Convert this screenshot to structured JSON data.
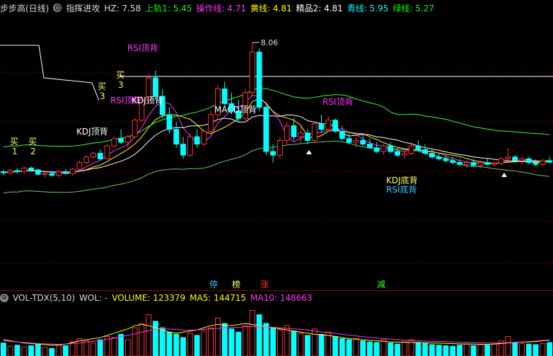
{
  "header": {
    "title": "步步高(日线)",
    "indicator": "指挥进攻",
    "items": [
      {
        "label": "HZ:",
        "value": "7.58",
        "color": "#e0e0e0"
      },
      {
        "label": "上轨1:",
        "value": "5.45",
        "color": "#00ff00"
      },
      {
        "label": "操作线:",
        "value": "4.71",
        "color": "#ff33ff"
      },
      {
        "label": "黄线:",
        "value": "4.81",
        "color": "#ffff00"
      },
      {
        "label": "精品2:",
        "value": "4.81",
        "color": "#ffffff"
      },
      {
        "label": "青线:",
        "value": "5.95",
        "color": "#00ffff"
      },
      {
        "label": "绿线:",
        "value": "5.27",
        "color": "#00ff00"
      }
    ]
  },
  "vol_header": {
    "name": "VOL-TDX(5,10)",
    "wol_label": "WOL: -",
    "volume_label": "VOLUME: 123379",
    "ma5_label": "MA5: 144715",
    "ma10_label": "MA10: 148663"
  },
  "annotations": {
    "max_price": "8.06",
    "rsi_top_1": "RSI顶背",
    "rsi_top_2": "RSI顶背",
    "rsi_top_3": "RSI顶背",
    "kdj_top_1": "KDJ顶背",
    "kdj_top_2": "KDJ顶背",
    "macd_top": "MACD顶背",
    "kdj_bottom": "KDJ底背",
    "rsi_bottom": "RSI底背",
    "buy_1": "买",
    "buy_1_num": "1",
    "buy_2": "买",
    "buy_2_num": "2",
    "buy_3a": "买",
    "buy_3a_num": "3",
    "buy_3b": "买",
    "buy_3b_num": "3",
    "mark_ting": "停",
    "mark_bang": "榜",
    "mark_zhang": "涨",
    "mark_jian": "减"
  },
  "colors": {
    "up": "#ff3333",
    "down": "#00ffff",
    "ma_yellow": "#ffff00",
    "ma_white": "#ffffff",
    "ma_magenta": "#ff33ff",
    "ma_green": "#33ff33",
    "ma_lightgreen": "#66cc66",
    "annotation_magenta": "#ff33ff",
    "annotation_white": "#ffffff",
    "annotation_yellow": "#ffff66",
    "annotation_cyan": "#33ccff"
  },
  "chart_data": {
    "type": "candlestick",
    "max_price": 8.06,
    "candles": [
      [
        4.55,
        4.6,
        4.45,
        4.52
      ],
      [
        4.52,
        4.62,
        4.48,
        4.58
      ],
      [
        4.58,
        4.65,
        4.5,
        4.55
      ],
      [
        4.55,
        4.7,
        4.5,
        4.65
      ],
      [
        4.65,
        4.7,
        4.55,
        4.6
      ],
      [
        4.6,
        4.62,
        4.45,
        4.48
      ],
      [
        4.48,
        4.55,
        4.4,
        4.5
      ],
      [
        4.5,
        4.58,
        4.42,
        4.45
      ],
      [
        4.45,
        4.6,
        4.4,
        4.55
      ],
      [
        4.55,
        4.62,
        4.48,
        4.5
      ],
      [
        4.5,
        4.65,
        4.45,
        4.62
      ],
      [
        4.62,
        4.85,
        4.58,
        4.8
      ],
      [
        4.8,
        5.0,
        4.75,
        4.95
      ],
      [
        4.95,
        5.1,
        4.9,
        5.05
      ],
      [
        5.05,
        5.15,
        4.85,
        4.9
      ],
      [
        4.9,
        5.3,
        4.88,
        5.25
      ],
      [
        5.25,
        5.5,
        5.2,
        5.45
      ],
      [
        5.45,
        5.7,
        5.3,
        5.35
      ],
      [
        5.35,
        5.55,
        5.2,
        5.5
      ],
      [
        5.5,
        6.0,
        5.45,
        5.95
      ],
      [
        5.95,
        6.6,
        5.9,
        6.5
      ],
      [
        6.5,
        7.2,
        6.4,
        7.1
      ],
      [
        7.1,
        7.3,
        6.5,
        6.6
      ],
      [
        6.6,
        6.8,
        6.0,
        6.1
      ],
      [
        6.1,
        6.3,
        5.6,
        5.7
      ],
      [
        5.7,
        5.9,
        5.2,
        5.3
      ],
      [
        5.3,
        5.5,
        4.9,
        5.0
      ],
      [
        5.0,
        5.6,
        4.95,
        5.5
      ],
      [
        5.5,
        5.7,
        5.2,
        5.3
      ],
      [
        5.3,
        5.7,
        5.25,
        5.65
      ],
      [
        5.65,
        6.2,
        5.6,
        6.1
      ],
      [
        6.1,
        6.9,
        6.0,
        6.8
      ],
      [
        6.8,
        7.0,
        6.3,
        6.4
      ],
      [
        6.4,
        6.7,
        6.1,
        6.2
      ],
      [
        6.2,
        6.5,
        5.9,
        6.0
      ],
      [
        6.0,
        6.8,
        5.95,
        6.7
      ],
      [
        6.7,
        8.06,
        6.6,
        7.8
      ],
      [
        7.8,
        7.9,
        6.2,
        6.3
      ],
      [
        6.3,
        6.4,
        5.0,
        5.1
      ],
      [
        5.1,
        5.3,
        4.8,
        5.0
      ],
      [
        5.0,
        5.5,
        4.9,
        5.4
      ],
      [
        5.4,
        5.9,
        5.3,
        5.8
      ],
      [
        5.8,
        6.0,
        5.4,
        5.5
      ],
      [
        5.5,
        5.8,
        5.3,
        5.6
      ],
      [
        5.6,
        5.7,
        5.3,
        5.4
      ],
      [
        5.4,
        5.9,
        5.35,
        5.85
      ],
      [
        5.85,
        6.1,
        5.6,
        5.7
      ],
      [
        5.7,
        6.05,
        5.65,
        5.95
      ],
      [
        5.95,
        6.0,
        5.6,
        5.65
      ],
      [
        5.65,
        5.8,
        5.4,
        5.45
      ],
      [
        5.45,
        5.6,
        5.3,
        5.35
      ],
      [
        5.35,
        5.5,
        5.2,
        5.4
      ],
      [
        5.4,
        5.55,
        5.25,
        5.3
      ],
      [
        5.3,
        5.45,
        5.15,
        5.2
      ],
      [
        5.2,
        5.35,
        5.05,
        5.1
      ],
      [
        5.1,
        5.3,
        5.0,
        5.25
      ],
      [
        5.25,
        5.35,
        5.05,
        5.1
      ],
      [
        5.1,
        5.2,
        4.95,
        5.0
      ],
      [
        5.0,
        5.15,
        4.9,
        5.05
      ],
      [
        5.05,
        5.3,
        5.0,
        5.25
      ],
      [
        5.25,
        5.4,
        5.1,
        5.15
      ],
      [
        5.15,
        5.3,
        5.0,
        5.05
      ],
      [
        5.05,
        5.15,
        4.9,
        4.95
      ],
      [
        4.95,
        5.05,
        4.85,
        4.9
      ],
      [
        4.9,
        5.0,
        4.8,
        4.85
      ],
      [
        4.85,
        4.95,
        4.75,
        4.8
      ],
      [
        4.8,
        4.9,
        4.7,
        4.75
      ],
      [
        4.75,
        4.85,
        4.65,
        4.8
      ],
      [
        4.8,
        4.9,
        4.7,
        4.72
      ],
      [
        4.72,
        4.85,
        4.65,
        4.8
      ],
      [
        4.8,
        4.9,
        4.72,
        4.75
      ],
      [
        4.75,
        4.85,
        4.68,
        4.78
      ],
      [
        4.78,
        4.95,
        4.72,
        4.9
      ],
      [
        4.9,
        5.2,
        4.85,
        4.95
      ],
      [
        4.95,
        5.0,
        4.8,
        4.85
      ],
      [
        4.85,
        4.95,
        4.75,
        4.9
      ],
      [
        4.9,
        4.95,
        4.75,
        4.8
      ],
      [
        4.8,
        4.88,
        4.7,
        4.75
      ],
      [
        4.75,
        4.9,
        4.7,
        4.85
      ],
      [
        4.85,
        4.95,
        4.78,
        4.81
      ]
    ],
    "volumes": [
      120,
      90,
      100,
      85,
      95,
      110,
      80,
      70,
      100,
      95,
      130,
      160,
      140,
      120,
      150,
      180,
      170,
      200,
      150,
      260,
      300,
      380,
      320,
      260,
      220,
      200,
      170,
      210,
      190,
      230,
      260,
      350,
      300,
      250,
      220,
      280,
      420,
      380,
      300,
      260,
      240,
      280,
      230,
      210,
      190,
      250,
      200,
      220,
      180,
      160,
      150,
      160,
      140,
      130,
      125,
      150,
      120,
      110,
      130,
      150,
      125,
      115,
      105,
      100,
      95,
      90,
      100,
      110,
      95,
      105,
      100,
      110,
      140,
      180,
      120,
      115,
      110,
      105,
      115,
      124
    ],
    "ma5_series": [
      150,
      140,
      130,
      120,
      115,
      110,
      105,
      100,
      100,
      110,
      125,
      140,
      150,
      160,
      170,
      190,
      210,
      230,
      250,
      280,
      290,
      280,
      260,
      240,
      220,
      210,
      220,
      230,
      240,
      260,
      280,
      290,
      285,
      280,
      290,
      300,
      290,
      280,
      270,
      260,
      250,
      240,
      230,
      220,
      210,
      200,
      195,
      190,
      180,
      170,
      160,
      155,
      150,
      145,
      140,
      135,
      130,
      128,
      126,
      125,
      124,
      122,
      120,
      118,
      116,
      114,
      112,
      110,
      109,
      108,
      108,
      110,
      115,
      120,
      125,
      128,
      130,
      132,
      140,
      144.7
    ],
    "ma10_series": [
      140,
      135,
      130,
      125,
      120,
      115,
      112,
      110,
      108,
      110,
      115,
      120,
      128,
      135,
      145,
      155,
      165,
      178,
      190,
      205,
      220,
      235,
      245,
      250,
      248,
      245,
      240,
      238,
      240,
      245,
      250,
      255,
      260,
      262,
      265,
      270,
      272,
      270,
      268,
      265,
      260,
      255,
      250,
      245,
      240,
      230,
      222,
      215,
      208,
      200,
      192,
      185,
      178,
      172,
      166,
      160,
      155,
      150,
      146,
      143,
      140,
      138,
      136,
      134,
      132,
      130,
      128,
      126,
      124,
      122,
      120,
      120,
      121,
      123,
      126,
      130,
      134,
      138,
      144,
      148.7
    ]
  }
}
